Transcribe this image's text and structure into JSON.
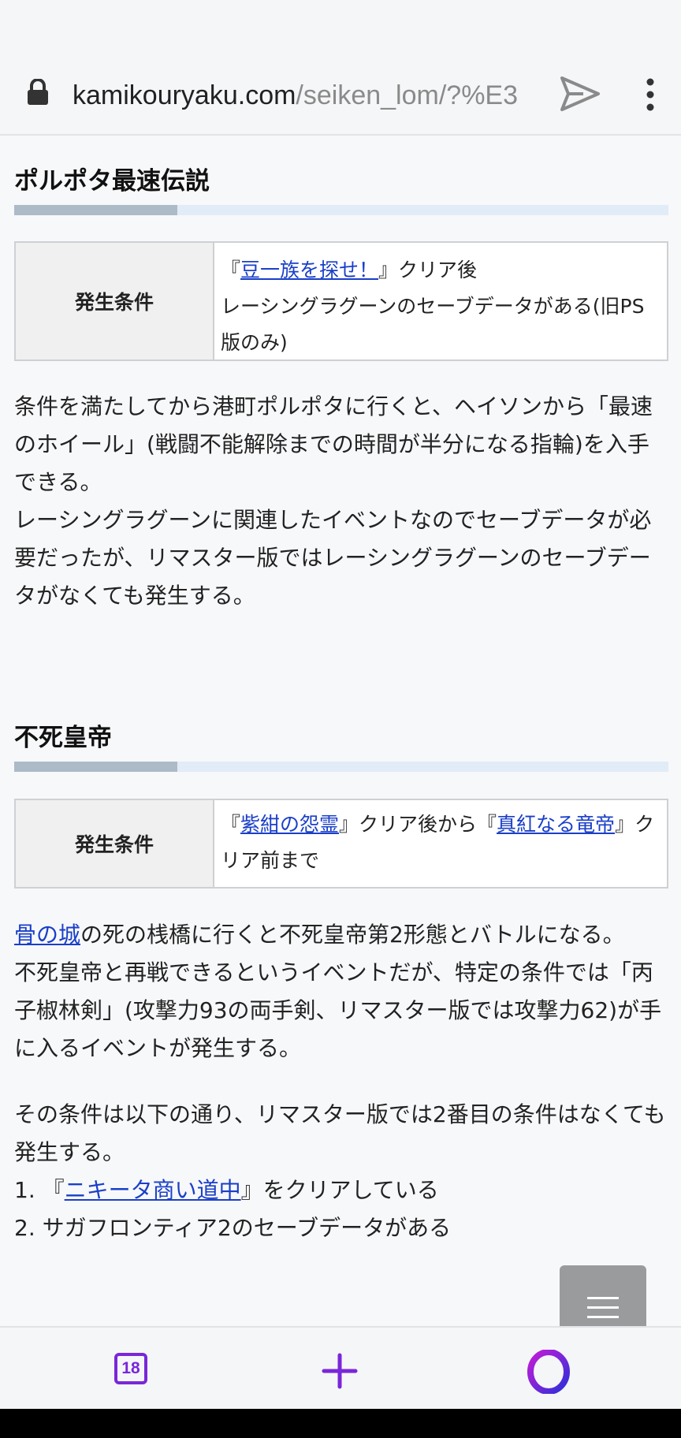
{
  "browser": {
    "url_host": "kamikouryaku.com",
    "url_path": "/seiken_lom/?%E3",
    "tab_count": "18"
  },
  "section1": {
    "title": "ポルポタ最速伝説",
    "condition_label": "発生条件",
    "cond_pre": "『",
    "cond_link": "豆一族を探せ！",
    "cond_post": "』クリア後",
    "cond_line2": "レーシングラグーンのセーブデータがある(旧PS版のみ)",
    "para_line1": "条件を満たしてから港町ポルポタに行くと、ヘイソンから「最速のホイール」(戦闘不能解除までの時間が半分になる指輪)を入手できる。",
    "para_line2": "レーシングラグーンに関連したイベントなのでセーブデータが必要だったが、リマスター版ではレーシングラグーンのセーブデータがなくても発生する。"
  },
  "section2": {
    "title": "不死皇帝",
    "condition_label": "発生条件",
    "cond_pre": "『",
    "cond_link1": "紫紺の怨霊",
    "cond_mid": "』クリア後から『",
    "cond_link2": "真紅なる竜帝",
    "cond_post": "』クリア前まで",
    "para1_link": "骨の城",
    "para1_rest": "の死の桟橋に行くと不死皇帝第2形態とバトルになる。",
    "para1_line2": "不死皇帝と再戦できるというイベントだが、特定の条件では「丙子椒林剣」(攻撃力93の両手剣、リマスター版では攻撃力62)が手に入るイベントが発生する。",
    "para2_line1": "その条件は以下の通り、リマスター版では2番目の条件はなくても発生する。",
    "list1_pre": "1. 『",
    "list1_link": "ニキータ商い道中",
    "list1_post": "』をクリアしている",
    "list2": "2. サガフロンティア2のセーブデータがある"
  },
  "colors": {
    "accent_purple": "#7a26d9",
    "link_blue": "#1a3fc8",
    "title_bar": "#e1ecf8",
    "title_bar_accent": "#adbac8"
  },
  "icons": [
    "lock-icon",
    "send-icon",
    "more-vert-icon",
    "menu-icon",
    "tabs-icon",
    "plus-icon",
    "opera-icon"
  ]
}
